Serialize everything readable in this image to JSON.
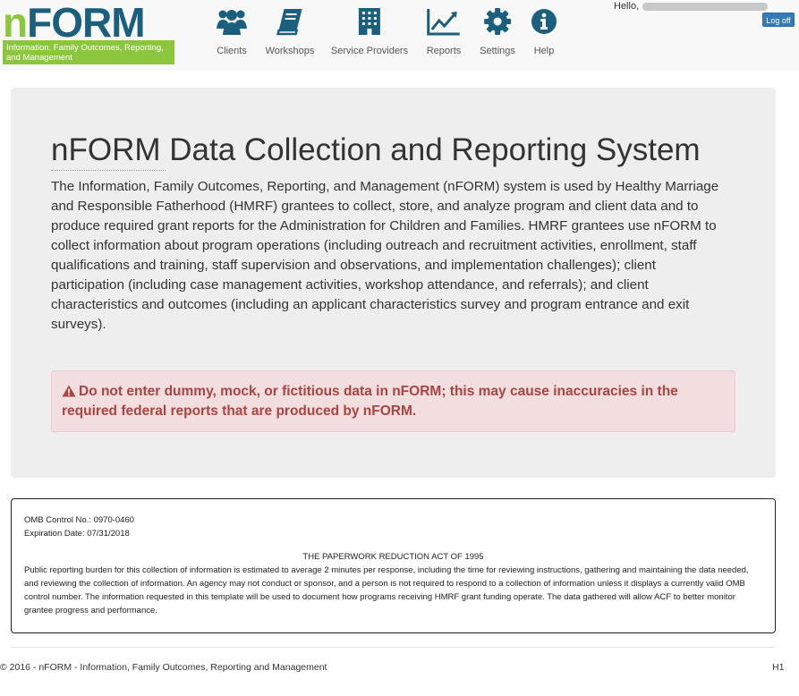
{
  "logo": {
    "n": "n",
    "form": "FORM",
    "tagline": "Information, Family Outcomes, Reporting, and Management"
  },
  "nav": [
    {
      "label": "Clients",
      "icon": "users-icon"
    },
    {
      "label": "Workshops",
      "icon": "book-icon"
    },
    {
      "label": "Service Providers",
      "icon": "building-icon"
    },
    {
      "label": "Reports",
      "icon": "line-chart-icon"
    },
    {
      "label": "Settings",
      "icon": "gear-icon"
    },
    {
      "label": "Help",
      "icon": "info-icon"
    }
  ],
  "user": {
    "greeting": "Hello,",
    "logoff_label": "Log off"
  },
  "main": {
    "title": "nFORM Data Collection and Reporting System",
    "intro": "The Information, Family Outcomes, Reporting, and Management (nFORM) system is used by Healthy Marriage and Responsible Fatherhood (HMRF) grantees to collect, store, and analyze program and client data and to produce required grant reports for the Administration for Children and Families. HMRF grantees use nFORM to collect information about program operations (including outreach and recruitment activities, enrollment, staff qualifications and training, staff supervision and observations, and implementation challenges); client participation (including case management activities, workshop attendance, and referrals); and client characteristics and outcomes (including an applicant characteristics survey and program entrance and exit surveys).",
    "alert": "Do not enter dummy, mock, or fictitious data in nFORM; this may cause inaccuracies in the required federal reports that are produced by nFORM."
  },
  "omb": {
    "control_no": "OMB Control No.: 0970-0460",
    "expiration": "Expiration Date: 07/31/2018",
    "act_title": "THE PAPERWORK REDUCTION ACT OF 1995",
    "body": "Public reporting burden for this collection of information is estimated to average 2 minutes per response, including the time for reviewing instructions, gathering and maintaining the data needed, and reviewing the collection of information. An agency may not conduct or sponsor, and a person is not required to respond to a collection of information unless it displays a currently valid OMB control number. The information requested in this template will be used to document how programs receiving HMRF grant funding operate. The data gathered will allow ACF to better monitor grantee progress and performance."
  },
  "footer": {
    "copyright": "© 2016 - nFORM - Information, Family Outcomes, Reporting and Management",
    "code": "H1"
  },
  "colors": {
    "brand_green": "#8cc63f",
    "brand_blue": "#1b5f7e",
    "alert_text": "#a94442",
    "alert_bg": "#f2dede"
  }
}
